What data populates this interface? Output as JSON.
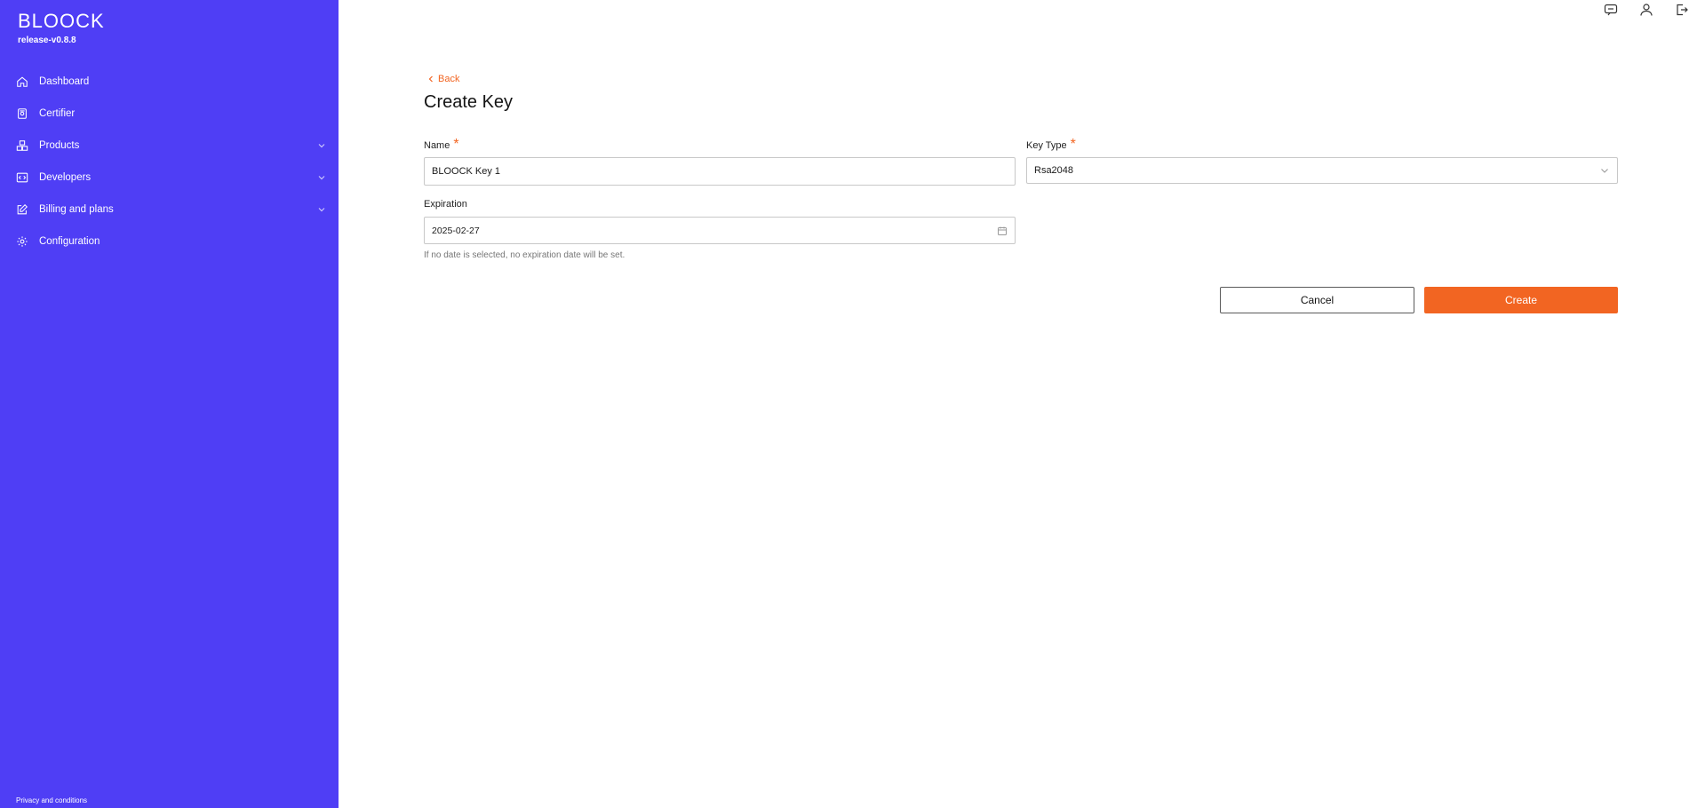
{
  "brand": {
    "logo": "BLOOCK",
    "version": "release-v0.8.8"
  },
  "sidebar": {
    "items": [
      {
        "label": "Dashboard",
        "icon": "home-icon"
      },
      {
        "label": "Certifier",
        "icon": "document-icon"
      },
      {
        "label": "Products",
        "icon": "boxes-icon",
        "expandable": true
      },
      {
        "label": "Developers",
        "icon": "code-icon",
        "expandable": true
      },
      {
        "label": "Billing and plans",
        "icon": "edit-icon",
        "expandable": true
      },
      {
        "label": "Configuration",
        "icon": "gear-icon"
      }
    ],
    "footer": "Privacy and conditions"
  },
  "topbar": {
    "icons": [
      "chat-icon",
      "user-icon",
      "logout-icon"
    ]
  },
  "page": {
    "back_label": "Back",
    "title": "Create Key"
  },
  "form": {
    "name": {
      "label": "Name",
      "required_mark": "*",
      "value": "BLOOCK Key 1"
    },
    "key_type": {
      "label": "Key Type",
      "required_mark": "*",
      "value": "Rsa2048"
    },
    "expiration": {
      "label": "Expiration",
      "value": "2025-02-27",
      "helper": "If no date is selected, no expiration date will be set."
    }
  },
  "actions": {
    "cancel_label": "Cancel",
    "create_label": "Create"
  },
  "colors": {
    "sidebar": "#4f3ef5",
    "accent": "#f26522"
  }
}
